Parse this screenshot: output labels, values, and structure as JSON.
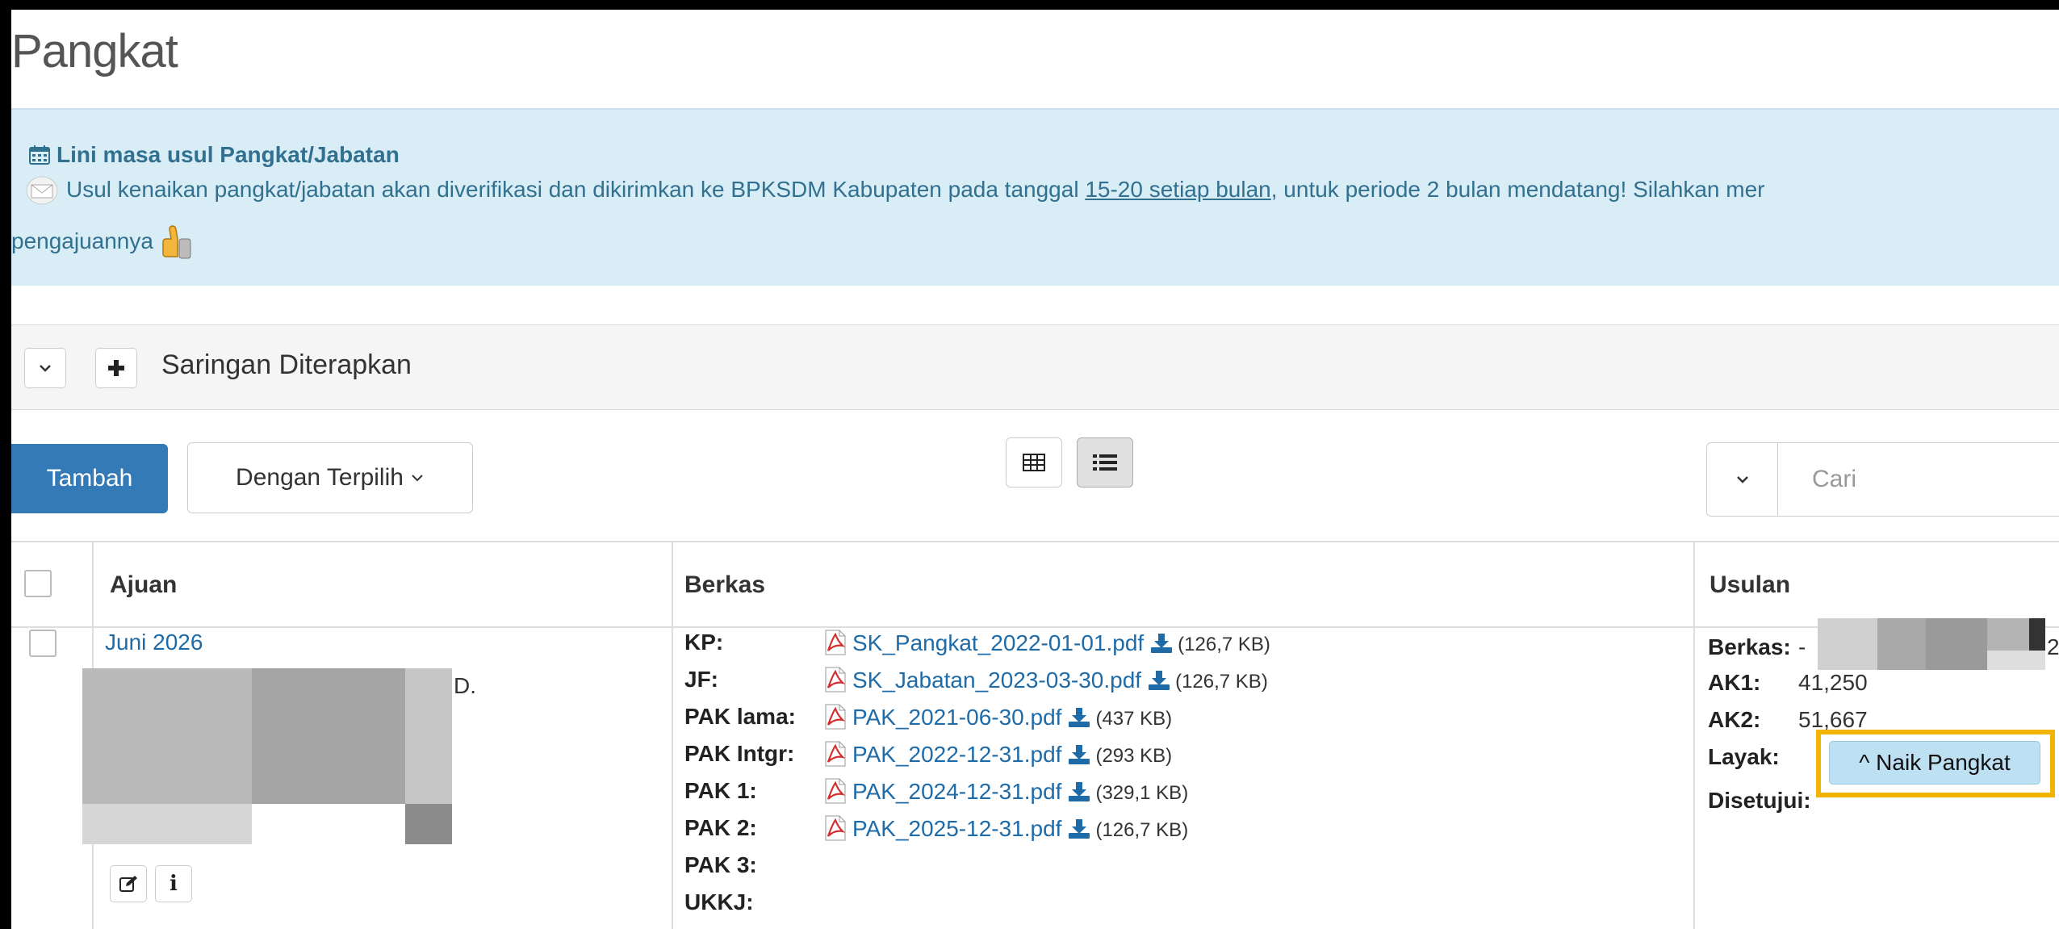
{
  "page": {
    "title": "Pangkat"
  },
  "callout": {
    "heading": "Lini masa usul Pangkat/Jabatan",
    "text_before": "Usul kenaikan pangkat/jabatan akan diverifikasi dan dikirimkan ke BPKSDM Kabupaten pada tanggal ",
    "text_link": "15-20 setiap bulan",
    "text_after": ", untuk periode 2 bulan mendatang! Silahkan mer",
    "line2": "pengajuannya"
  },
  "filter": {
    "label": "Saringan Diterapkan"
  },
  "toolbar": {
    "tambah_label": "Tambah",
    "dengan_label": "Dengan Terpilih",
    "search_placeholder": "Cari"
  },
  "table": {
    "headers": {
      "ajuan": "Ajuan",
      "berkas": "Berkas",
      "usulan": "Usulan"
    },
    "row": {
      "ajuan_link": "Juni 2026",
      "ajuan_name_suffix": "D.",
      "berkas": [
        {
          "label": "KP:",
          "file": "SK_Pangkat_2022-01-01.pdf",
          "size": "(126,7 KB)"
        },
        {
          "label": "JF:",
          "file": "SK_Jabatan_2023-03-30.pdf",
          "size": "(126,7 KB)"
        },
        {
          "label": "PAK lama:",
          "file": "PAK_2021-06-30.pdf",
          "size": "(437 KB)"
        },
        {
          "label": "PAK Intgr:",
          "file": "PAK_2022-12-31.pdf",
          "size": "(293 KB)"
        },
        {
          "label": "PAK 1:",
          "file": "PAK_2024-12-31.pdf",
          "size": "(329,1 KB)"
        },
        {
          "label": "PAK 2:",
          "file": "PAK_2025-12-31.pdf",
          "size": "(126,7 KB)"
        },
        {
          "label": "PAK 3:",
          "file": "",
          "size": ""
        },
        {
          "label": "UKKJ:",
          "file": "",
          "size": ""
        }
      ],
      "usulan": {
        "berkas_label": "Berkas:",
        "berkas_value": "-",
        "berkas_tail": "2",
        "ak1_label": "AK1:",
        "ak1_value": "41,250",
        "ak2_label": "AK2:",
        "ak2_value": "51,667",
        "layak_label": "Layak:",
        "layak_button": "^ Naik Pangkat",
        "disetujui_label": "Disetujui:"
      }
    }
  },
  "colors": {
    "primary": "#337ab7",
    "callout_bg": "#d9edf7",
    "callout_text": "#31708f",
    "highlight": "#f2b400",
    "link": "#1f6ba8"
  }
}
